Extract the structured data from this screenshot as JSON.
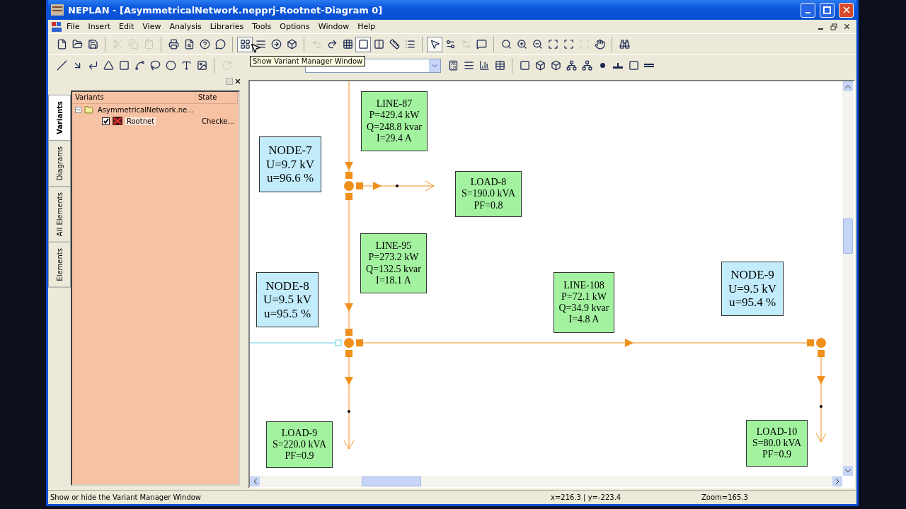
{
  "window": {
    "title": "NEPLAN - [AsymmetricalNetwork.nepprj-Rootnet-Diagram 0]"
  },
  "menu": [
    "File",
    "Insert",
    "Edit",
    "View",
    "Analysis",
    "Libraries",
    "Tools",
    "Options",
    "Window",
    "Help"
  ],
  "toolbar_1": [
    {
      "disabled": false,
      "pressed": false
    },
    {
      "disabled": false,
      "pressed": false
    },
    {
      "disabled": false,
      "pressed": false
    },
    {
      "disabled": true,
      "pressed": false
    },
    {
      "disabled": true,
      "pressed": false
    },
    {
      "disabled": true,
      "pressed": false
    },
    {
      "disabled": false,
      "pressed": false
    },
    {
      "disabled": false,
      "pressed": false
    },
    {
      "disabled": false,
      "pressed": false
    },
    {
      "disabled": false,
      "pressed": false
    },
    {
      "disabled": false,
      "pressed": true
    },
    {
      "disabled": false,
      "pressed": false
    },
    {
      "disabled": false,
      "pressed": false
    },
    {
      "disabled": false,
      "pressed": false
    },
    {
      "disabled": true,
      "pressed": false
    },
    {
      "disabled": false,
      "pressed": false
    },
    {
      "disabled": false,
      "pressed": false
    },
    {
      "disabled": false,
      "pressed": true
    },
    {
      "disabled": false,
      "pressed": false
    },
    {
      "disabled": false,
      "pressed": false
    },
    {
      "disabled": false,
      "pressed": false
    },
    {
      "disabled": false,
      "pressed": true
    },
    {
      "disabled": false,
      "pressed": false
    },
    {
      "disabled": true,
      "pressed": false
    },
    {
      "disabled": false,
      "pressed": false
    },
    {
      "disabled": false,
      "pressed": false
    },
    {
      "disabled": false,
      "pressed": false
    },
    {
      "disabled": false,
      "pressed": false
    },
    {
      "disabled": false,
      "pressed": false
    },
    {
      "disabled": false,
      "pressed": false
    },
    {
      "disabled": true,
      "pressed": false
    },
    {
      "disabled": false,
      "pressed": false
    },
    {
      "disabled": false,
      "pressed": false
    }
  ],
  "toolbar_2": [
    {
      "disabled": false
    },
    {
      "disabled": false
    },
    {
      "disabled": false
    },
    {
      "disabled": false
    },
    {
      "disabled": false
    },
    {
      "disabled": false
    },
    {
      "disabled": false
    },
    {
      "disabled": false
    },
    {
      "disabled": false
    },
    {
      "disabled": false
    },
    {
      "disabled": true
    },
    {
      "disabled": false
    },
    {
      "disabled": false
    },
    {
      "disabled": false
    },
    {
      "disabled": false
    },
    {
      "disabled": false
    },
    {
      "disabled": false
    },
    {
      "disabled": false
    },
    {
      "disabled": false
    },
    {
      "disabled": false
    },
    {
      "disabled": false
    },
    {
      "disabled": false
    },
    {
      "disabled": false
    },
    {
      "disabled": false
    }
  ],
  "tooltip": "Show Variant Manager Window",
  "side_tabs": [
    {
      "label": "Variants",
      "selected": true
    },
    {
      "label": "Diagrams",
      "selected": false
    },
    {
      "label": "All Elements",
      "selected": false
    },
    {
      "label": "Elements",
      "selected": false
    }
  ],
  "variants": {
    "columns": [
      "Variants",
      "State"
    ],
    "tree": [
      {
        "label": "AsymmetricalNetwork.ne...",
        "expanded": true,
        "children": [
          {
            "label": "Rootnet",
            "checked": true,
            "selected": true,
            "state": "Checke..."
          }
        ]
      }
    ]
  },
  "diagram": {
    "elements": [
      {
        "kind": "line",
        "lines": [
          "LINE-87",
          "P=429.4 kW",
          "Q=248.8 kvar",
          "I=29.4 A"
        ]
      },
      {
        "kind": "node",
        "lines": [
          "NODE-7",
          "U=9.7 kV",
          "u=96.6 %"
        ]
      },
      {
        "kind": "load",
        "lines": [
          "LOAD-8",
          "S=190.0 kVA",
          "PF=0.8"
        ]
      },
      {
        "kind": "line",
        "lines": [
          "LINE-95",
          "P=273.2 kW",
          "Q=132.5 kvar",
          "I=18.1 A"
        ]
      },
      {
        "kind": "node",
        "lines": [
          "NODE-9",
          "U=9.5 kV",
          "u=95.4 %"
        ]
      },
      {
        "kind": "node",
        "lines": [
          "NODE-8",
          "U=9.5 kV",
          "u=95.5 %"
        ]
      },
      {
        "kind": "line",
        "lines": [
          "LINE-108",
          "P=72.1 kW",
          "Q=34.9 kvar",
          "I=4.8 A"
        ]
      },
      {
        "kind": "load",
        "lines": [
          "LOAD-9",
          "S=220.0 kVA",
          "PF=0.9"
        ]
      },
      {
        "kind": "load",
        "lines": [
          "LOAD-10",
          "S=80.0 kVA",
          "PF=0.9"
        ]
      }
    ]
  },
  "status_bar": {
    "message": "Show or hide the Variant Manager Window",
    "coordinates": "x=216.3 | y=-223.4",
    "zoom": "Zoom=165.3"
  }
}
